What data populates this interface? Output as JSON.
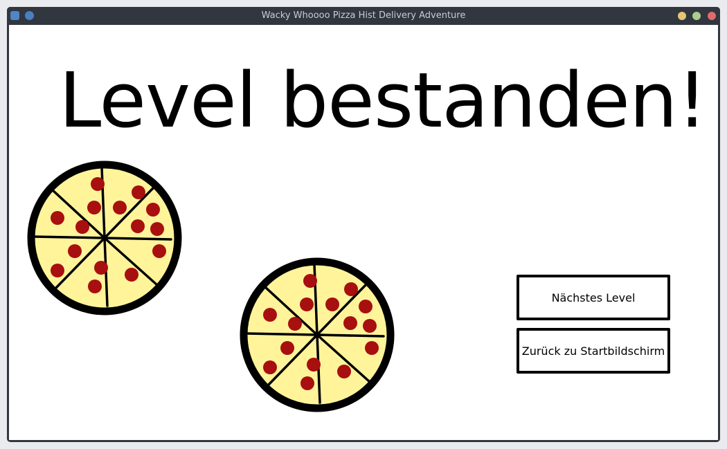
{
  "window": {
    "title": "Wacky Whoooo Pizza Hist Delivery Adventure"
  },
  "main": {
    "heading": "Level bestanden!",
    "buttons": {
      "next_label": "Nächstes Level",
      "back_label": "Zurück zu Startbildschirm"
    }
  },
  "colors": {
    "crust": "#000000",
    "cheese": "#fff49a",
    "pepperoni": "#a80f0f",
    "titlebar": "#31363f",
    "background": "#ffffff"
  },
  "icons": [
    "app-icon",
    "pin-icon",
    "minimize-icon",
    "maximize-icon",
    "close-icon",
    "pizza-icon"
  ],
  "pizzas_count": 2
}
